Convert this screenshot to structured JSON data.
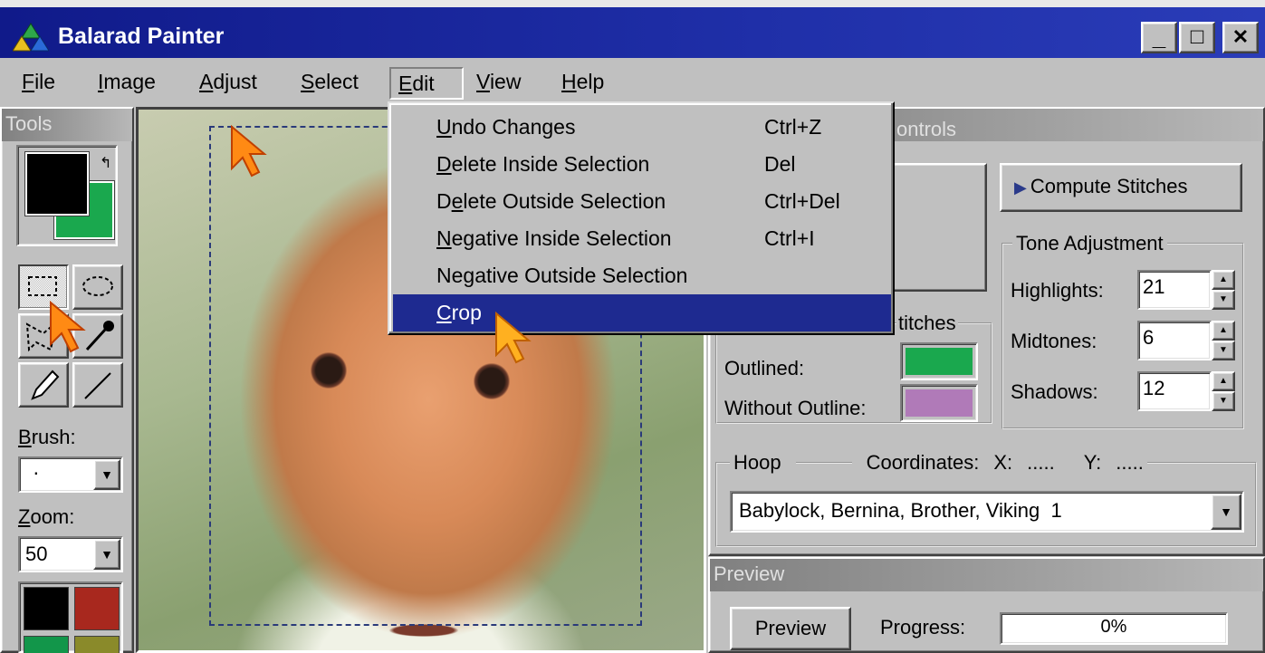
{
  "window": {
    "title": "Balarad Painter",
    "minimize": "_",
    "maximize": "□",
    "close": "✕"
  },
  "menubar": {
    "items": [
      {
        "key": "F",
        "rest": "ile"
      },
      {
        "key": "I",
        "rest": "mage"
      },
      {
        "key": "A",
        "rest": "djust"
      },
      {
        "key": "S",
        "rest": "elect"
      },
      {
        "key": "E",
        "rest": "dit"
      },
      {
        "key": "V",
        "rest": "iew"
      },
      {
        "key": "H",
        "rest": "elp"
      }
    ]
  },
  "edit_menu": {
    "items": [
      {
        "pre": "",
        "key": "U",
        "post": "ndo Changes",
        "shortcut": "Ctrl+Z"
      },
      {
        "pre": "",
        "key": "D",
        "post": "elete Inside Selection",
        "shortcut": "Del"
      },
      {
        "pre": "D",
        "key": "e",
        "post": "lete Outside Selection",
        "shortcut": "Ctrl+Del"
      },
      {
        "pre": "",
        "key": "N",
        "post": "egative Inside Selection",
        "shortcut": "Ctrl+I"
      },
      {
        "pre": "Negative Outside Selection",
        "key": "",
        "post": "",
        "shortcut": ""
      },
      {
        "pre": "",
        "key": "C",
        "post": "rop",
        "shortcut": ""
      }
    ],
    "selected_index": 5
  },
  "tools": {
    "caption": "Tools",
    "swap_glyph": "↰",
    "foreground_color": "#000000",
    "background_color": "#1aa84e",
    "brush_key": "B",
    "brush_rest": "rush:",
    "brush_value": "·",
    "zoom_key": "Z",
    "zoom_rest": "oom:",
    "zoom_value": "50",
    "palette": [
      "#000000",
      "#a8281e",
      "#12964a",
      "#8a8a2a"
    ]
  },
  "controls": {
    "caption_visible": "ontrols",
    "compute_button": "Compute Stitches",
    "tone_adjustment": {
      "legend": "Tone Adjustment",
      "highlights_label": "Highlights:",
      "highlights_value": "21",
      "midtones_label": "Midtones:",
      "midtones_value": "6",
      "shadows_label": "Shadows:",
      "shadows_value": "12"
    },
    "stitches": {
      "legend_visible": "titches",
      "outlined_label": "Outlined:",
      "outlined_color": "#1aa84e",
      "without_outline_label": "Without Outline:",
      "without_outline_color": "#b07ab8"
    },
    "hoop": {
      "legend": "Hoop",
      "coordinates_label": "Coordinates:",
      "x_label": "X:",
      "x_value": ".....",
      "y_label": "Y:",
      "y_value": ".....",
      "selected": "Babylock, Bernina, Brother, Viking  1"
    }
  },
  "preview": {
    "caption": "Preview",
    "button": "Preview",
    "progress_label": "Progress:",
    "progress_text": "0%",
    "progress_fraction": 0
  }
}
